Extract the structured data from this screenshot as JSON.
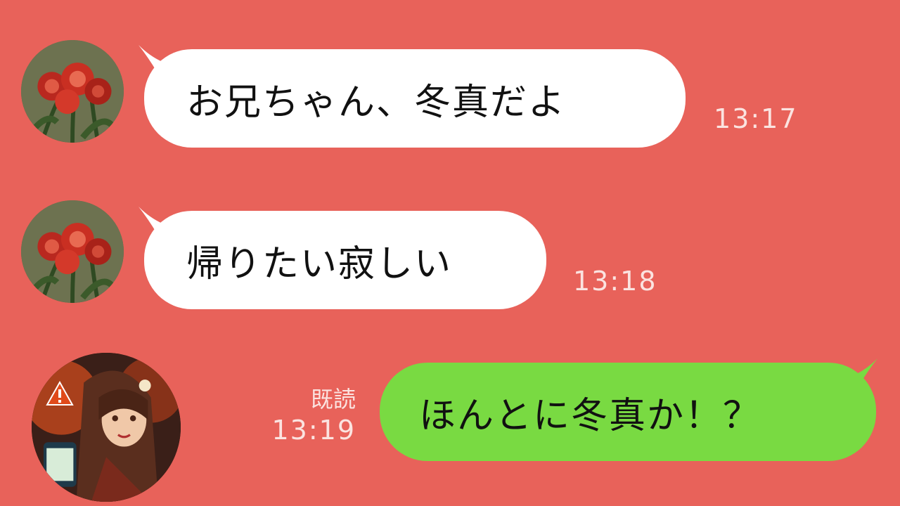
{
  "chat": {
    "messages": [
      {
        "sender": "other",
        "text": "お兄ちゃん、冬真だよ",
        "time": "13:17"
      },
      {
        "sender": "other",
        "text": "帰りたい寂しい",
        "time": "13:18"
      },
      {
        "sender": "me",
        "text": "ほんとに冬真か！？",
        "time": "13:19",
        "read_label": "既読"
      }
    ]
  },
  "colors": {
    "background": "#e8625a",
    "incoming_bubble": "#ffffff",
    "outgoing_bubble": "#79da42",
    "timestamp": "#fbe3e0"
  },
  "icons": {
    "contact_avatar": "red-tulips-avatar",
    "self_avatar": "character-portrait-avatar",
    "warning": "warning-triangle-icon"
  }
}
